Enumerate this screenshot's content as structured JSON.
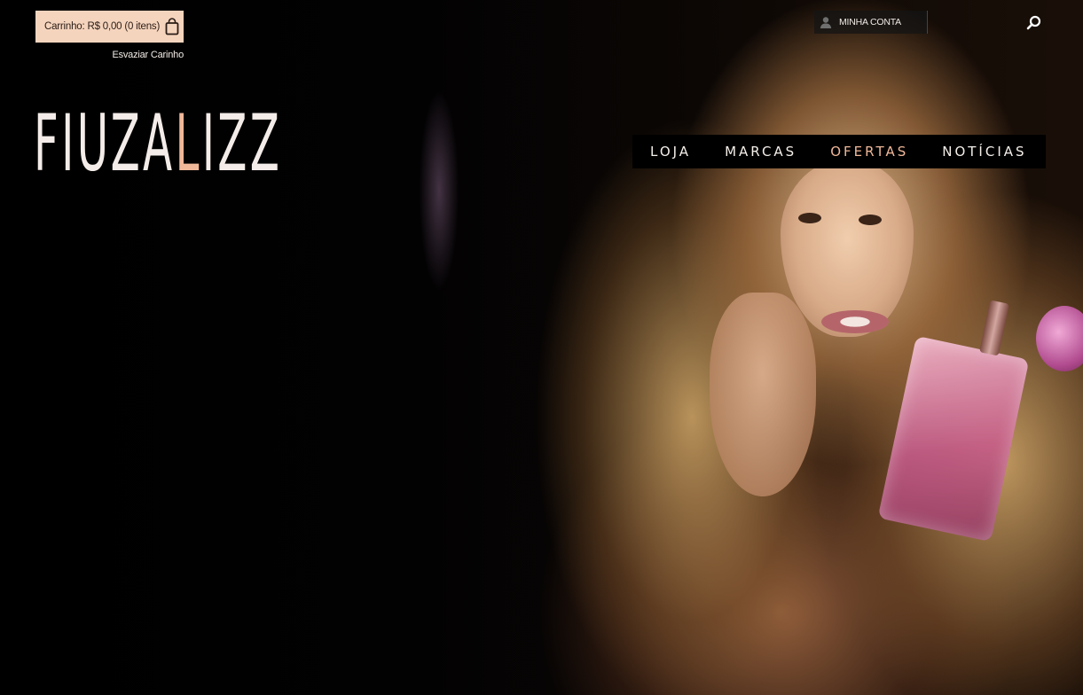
{
  "header": {
    "cart_label": "Carrinho: R$ 0,00 (0 itens)",
    "empty_cart_label": "Esvaziar Carinho",
    "account_label": "MINHA CONTA"
  },
  "logo": {
    "part1": "FIUZA",
    "part2": "L",
    "part3": "IZZ"
  },
  "nav": {
    "items": [
      {
        "label": "LOJA"
      },
      {
        "label": "MARCAS"
      },
      {
        "label": "OFERTAS"
      },
      {
        "label": "NOTÍCIAS"
      }
    ]
  },
  "colors": {
    "accent": "#f0b899",
    "cart_bg": "#f5d4bd",
    "background": "#000000"
  },
  "icons": {
    "cart": "shopping-bag-icon",
    "account": "user-icon",
    "search": "search-icon"
  }
}
